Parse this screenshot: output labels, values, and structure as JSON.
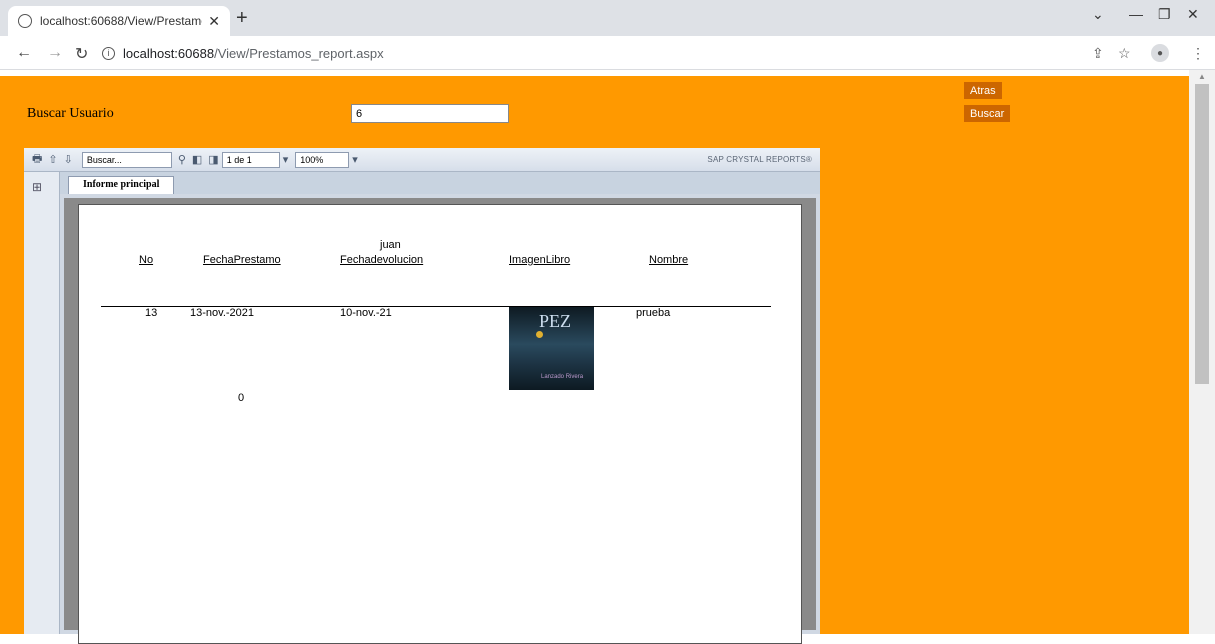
{
  "browser": {
    "tab_title": "localhost:60688/View/Prestamos",
    "url_host": "localhost:60688",
    "url_path": "/View/Prestamos_report.aspx"
  },
  "form": {
    "user_label": "Buscar Usuario",
    "user_value": "6",
    "back_label": "Atras",
    "search_label": "Buscar"
  },
  "viewer": {
    "search_placeholder": "Buscar...",
    "page_indicator": "1 de 1",
    "zoom": "100%",
    "brand": "SAP CRYSTAL REPORTS®",
    "tab_label": "Informe principal"
  },
  "report": {
    "group_name": "juan",
    "headers": [
      "No",
      "FechaPrestamo",
      "Fechadevolucion",
      "ImagenLibro",
      "Nombre"
    ],
    "row": {
      "no": "13",
      "fecha_prestamo": "13-nov.-2021",
      "fecha_devolucion": "10-nov.-21",
      "nombre": "prueba"
    },
    "footer_value": "0",
    "book_cover": {
      "title": "PEZ",
      "author": "Lanzado Rivera"
    }
  },
  "colors": {
    "page_bg": "#ff9900",
    "button_bg": "#cc6600"
  }
}
